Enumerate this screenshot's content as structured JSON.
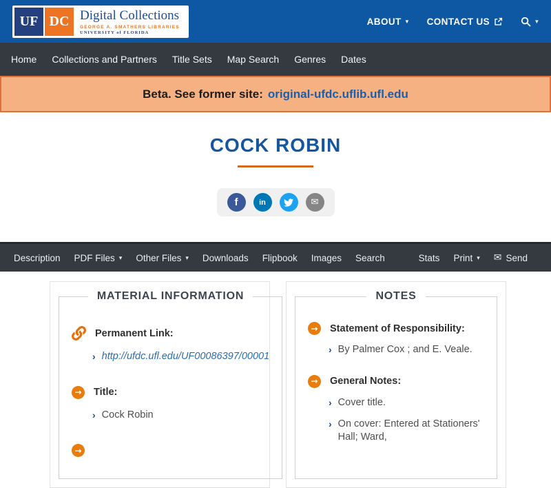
{
  "header": {
    "logo": {
      "uf": "UF",
      "dc": "DC",
      "title": "Digital Collections",
      "smathers": "GEORGE A. SMATHERS LIBRARIES",
      "university": "UNIVERSITY of FLORIDA"
    },
    "about": "ABOUT",
    "contact": "CONTACT US"
  },
  "nav": {
    "items": [
      "Home",
      "Collections and Partners",
      "Title Sets",
      "Map Search",
      "Genres",
      "Dates"
    ]
  },
  "beta": {
    "text": "Beta. See former site:",
    "link": "original-ufdc.uflib.ufl.edu"
  },
  "item": {
    "title": "COCK ROBIN"
  },
  "social": {
    "buttons": [
      {
        "name": "facebook",
        "glyph": "f",
        "color": "#3B5998"
      },
      {
        "name": "linkedin",
        "glyph": "in",
        "color": "#0077B5"
      },
      {
        "name": "twitter",
        "glyph": "bird",
        "color": "#1DA1F2"
      },
      {
        "name": "email",
        "glyph": "✉",
        "color": "#858585"
      }
    ]
  },
  "toolbar": {
    "left": [
      {
        "label": "Description"
      },
      {
        "label": "PDF Files",
        "caret": true
      },
      {
        "label": "Other Files",
        "caret": true
      },
      {
        "label": "Downloads"
      },
      {
        "label": "Flipbook"
      },
      {
        "label": "Images"
      },
      {
        "label": "Search"
      }
    ],
    "right": [
      {
        "label": "Stats"
      },
      {
        "label": "Print",
        "caret": true
      },
      {
        "label": "Send",
        "icon": "envelope"
      }
    ]
  },
  "icons": {
    "caret": "▾",
    "envelope": "✉",
    "chevron": "›",
    "arrow": "→"
  },
  "panels": [
    {
      "title": "MATERIAL INFORMATION",
      "fields": [
        {
          "icon": "link",
          "label": "Permanent Link:",
          "values": [
            {
              "text": "http://ufdc.ufl.edu/UF00086397/00001",
              "link": true
            }
          ]
        },
        {
          "icon": "arrow",
          "label": "Title:",
          "values": [
            {
              "text": "Cock Robin"
            }
          ]
        },
        {
          "icon": "arrow",
          "label": "",
          "values": []
        }
      ]
    },
    {
      "title": "NOTES",
      "fields": [
        {
          "icon": "arrow",
          "label": "Statement of Responsibility:",
          "values": [
            {
              "text": "By Palmer Cox ; and E. Veale."
            }
          ]
        },
        {
          "icon": "arrow",
          "label": "General Notes:",
          "values": [
            {
              "text": "Cover title."
            },
            {
              "text": "On cover: Entered at Stationers' Hall; Ward,"
            }
          ]
        }
      ]
    }
  ],
  "colors": {
    "header_blue": "#0E57A3",
    "nav_dark": "#343A40",
    "beta_bg": "#F6B183",
    "beta_border": "#E1713C",
    "beta_link": "#1A5FAE",
    "title_blue": "#15569E",
    "rule_orange": "#D4691E",
    "icon_orange": "#E87D0E",
    "chevron_blue": "#1D4F91",
    "url_blue": "#2A6CB5",
    "logo_navy": "#24407E",
    "logo_orange": "#EC7423"
  }
}
